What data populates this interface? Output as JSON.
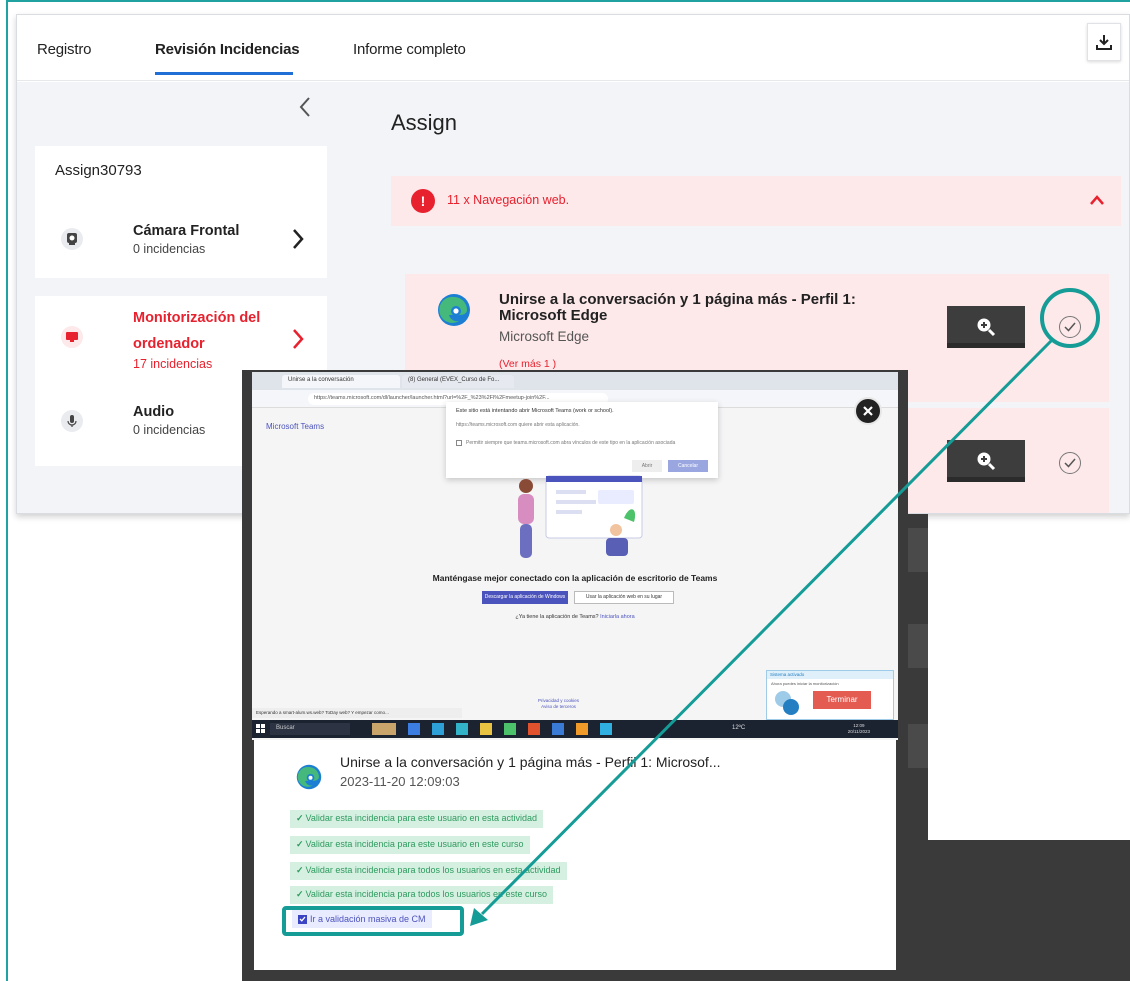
{
  "tabs": [
    {
      "label": "Registro"
    },
    {
      "label": "Revisión Incidencias"
    },
    {
      "label": "Informe completo"
    }
  ],
  "sidebar": {
    "title": "Assign30793",
    "items": [
      {
        "name": "Cámara Frontal",
        "count": "0 incidencias"
      },
      {
        "name": "Monitorización del",
        "name2": "ordenador",
        "count": "17 incidencias"
      },
      {
        "name": "Audio",
        "count": "0 incidencias"
      }
    ]
  },
  "main": {
    "title": "Assign",
    "alert": {
      "badge": "!",
      "text": "11 x Navegación web."
    },
    "incident": {
      "title": "Unirse a la conversación y 1 página más - Perfil 1: Microsoft Edge",
      "app": "Microsoft Edge",
      "more": "(Ver más 1 )"
    }
  },
  "screenshot": {
    "tab1": "Unirse a la conversación",
    "tab2": "(8) General (EVEX_Curso de Fo...",
    "address": "https://teams.microsoft.com/dl/launcher/launcher.html?url=%2F_%23%2Fl%2Fmeetup-join%2F...",
    "app_label": "Microsoft Teams",
    "dialog_line1": "Este sitio está intentando abrir Microsoft Teams (work or school).",
    "dialog_line2": "https://teams.microsoft.com quiere abrir esta aplicación.",
    "dialog_line3": "Permitir siempre que teams.microsoft.com abra vínculos de este tipo en la aplicación asociada",
    "dialog_open": "Abrir",
    "dialog_cancel": "Cancelar",
    "headline": "Manténgase mejor conectado con la aplicación de escritorio de Teams",
    "btn_download": "Descargar la aplicación de Windows",
    "btn_web": "Usar la aplicación web en su lugar",
    "link_prefix": "¿Ya tiene la aplicación de Teams?",
    "link": "Iniciarla ahora",
    "privacy": "Privacidad y cookies",
    "privacy2": "Aviso de terceros",
    "status": "Esperando a smart-alum.ws.web? ToDay web? Y empezar como...",
    "popup_head": "Sistema activado",
    "popup_sub": "Ahora puedes iniciar la monitorización",
    "terminar": "Terminar",
    "search": "Buscar",
    "temp": "12ºC",
    "time": "12:09",
    "date": "20/11/2023"
  },
  "detail": {
    "title": "Unirse a la conversación y 1 página más - Perfil 1: Microsof...",
    "datetime": "2023-11-20 12:09:03",
    "options": [
      "Validar esta incidencia para este usuario en esta actividad",
      "Validar esta incidencia para este usuario en este curso",
      "Validar esta incidencia para todos los usuarios en esta actividad",
      "Validar esta incidencia para todos los usuarios en este curso"
    ],
    "massive": "Ir a validación masiva de CM"
  },
  "colors": {
    "accent": "#1f6fd6",
    "alert": "#e8212e",
    "highlight": "#159c97",
    "valid": "#2e9a5e"
  }
}
